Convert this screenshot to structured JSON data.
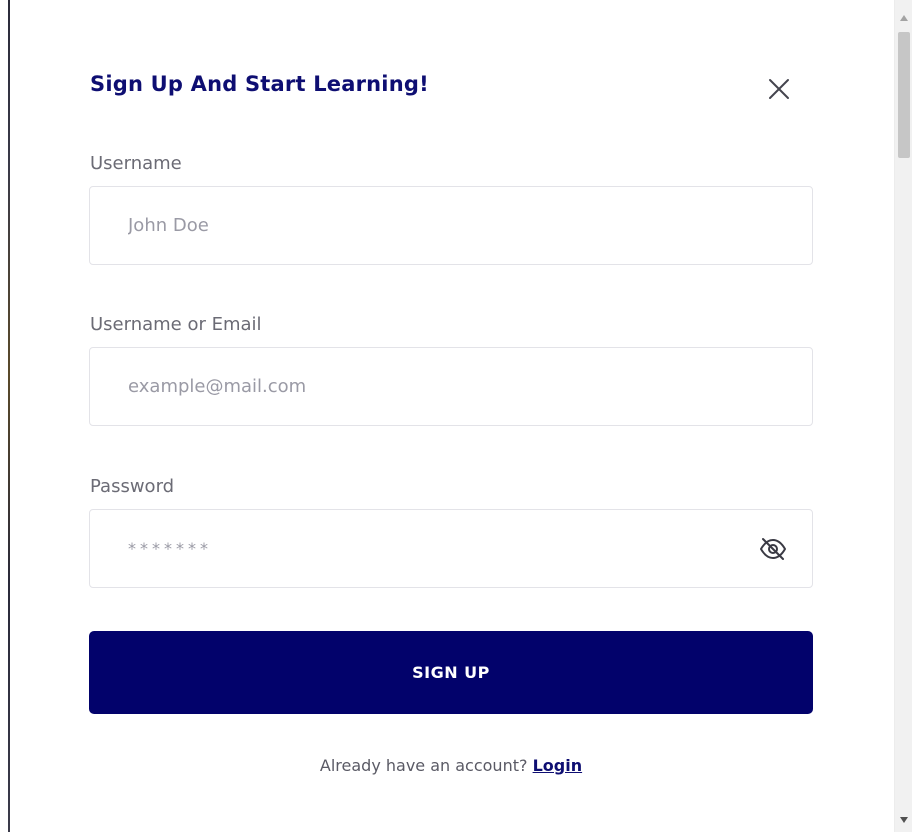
{
  "modal": {
    "title": "Sign Up And Start Learning!",
    "close_icon": "close-icon"
  },
  "form": {
    "username": {
      "label": "Username",
      "placeholder": "John Doe",
      "value": ""
    },
    "email": {
      "label": "Username or Email",
      "placeholder": "example@mail.com",
      "value": ""
    },
    "password": {
      "label": "Password",
      "placeholder": "*******",
      "value": "",
      "toggle_icon": "eye-off-icon"
    },
    "submit_label": "SIGN UP"
  },
  "footer": {
    "prompt": "Already have an account?",
    "login_link": "Login"
  },
  "colors": {
    "brand": "#02026b",
    "title": "#0e0e72",
    "label": "#6b6b75",
    "border": "#e3e3e8"
  }
}
